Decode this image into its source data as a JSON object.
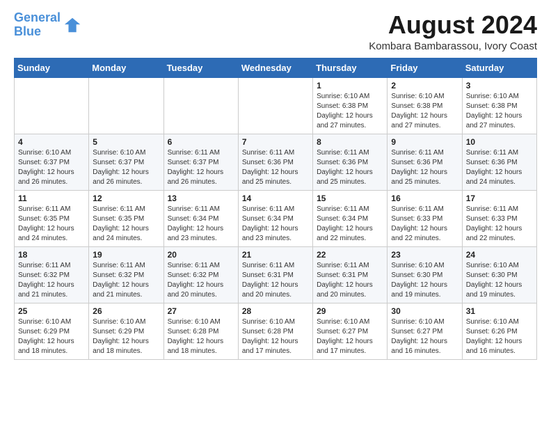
{
  "logo": {
    "line1": "General",
    "line2": "Blue"
  },
  "title": "August 2024",
  "subtitle": "Kombara Bambarassou, Ivory Coast",
  "days_of_week": [
    "Sunday",
    "Monday",
    "Tuesday",
    "Wednesday",
    "Thursday",
    "Friday",
    "Saturday"
  ],
  "weeks": [
    [
      {
        "day": "",
        "info": ""
      },
      {
        "day": "",
        "info": ""
      },
      {
        "day": "",
        "info": ""
      },
      {
        "day": "",
        "info": ""
      },
      {
        "day": "1",
        "info": "Sunrise: 6:10 AM\nSunset: 6:38 PM\nDaylight: 12 hours\nand 27 minutes."
      },
      {
        "day": "2",
        "info": "Sunrise: 6:10 AM\nSunset: 6:38 PM\nDaylight: 12 hours\nand 27 minutes."
      },
      {
        "day": "3",
        "info": "Sunrise: 6:10 AM\nSunset: 6:38 PM\nDaylight: 12 hours\nand 27 minutes."
      }
    ],
    [
      {
        "day": "4",
        "info": "Sunrise: 6:10 AM\nSunset: 6:37 PM\nDaylight: 12 hours\nand 26 minutes."
      },
      {
        "day": "5",
        "info": "Sunrise: 6:10 AM\nSunset: 6:37 PM\nDaylight: 12 hours\nand 26 minutes."
      },
      {
        "day": "6",
        "info": "Sunrise: 6:11 AM\nSunset: 6:37 PM\nDaylight: 12 hours\nand 26 minutes."
      },
      {
        "day": "7",
        "info": "Sunrise: 6:11 AM\nSunset: 6:36 PM\nDaylight: 12 hours\nand 25 minutes."
      },
      {
        "day": "8",
        "info": "Sunrise: 6:11 AM\nSunset: 6:36 PM\nDaylight: 12 hours\nand 25 minutes."
      },
      {
        "day": "9",
        "info": "Sunrise: 6:11 AM\nSunset: 6:36 PM\nDaylight: 12 hours\nand 25 minutes."
      },
      {
        "day": "10",
        "info": "Sunrise: 6:11 AM\nSunset: 6:36 PM\nDaylight: 12 hours\nand 24 minutes."
      }
    ],
    [
      {
        "day": "11",
        "info": "Sunrise: 6:11 AM\nSunset: 6:35 PM\nDaylight: 12 hours\nand 24 minutes."
      },
      {
        "day": "12",
        "info": "Sunrise: 6:11 AM\nSunset: 6:35 PM\nDaylight: 12 hours\nand 24 minutes."
      },
      {
        "day": "13",
        "info": "Sunrise: 6:11 AM\nSunset: 6:34 PM\nDaylight: 12 hours\nand 23 minutes."
      },
      {
        "day": "14",
        "info": "Sunrise: 6:11 AM\nSunset: 6:34 PM\nDaylight: 12 hours\nand 23 minutes."
      },
      {
        "day": "15",
        "info": "Sunrise: 6:11 AM\nSunset: 6:34 PM\nDaylight: 12 hours\nand 22 minutes."
      },
      {
        "day": "16",
        "info": "Sunrise: 6:11 AM\nSunset: 6:33 PM\nDaylight: 12 hours\nand 22 minutes."
      },
      {
        "day": "17",
        "info": "Sunrise: 6:11 AM\nSunset: 6:33 PM\nDaylight: 12 hours\nand 22 minutes."
      }
    ],
    [
      {
        "day": "18",
        "info": "Sunrise: 6:11 AM\nSunset: 6:32 PM\nDaylight: 12 hours\nand 21 minutes."
      },
      {
        "day": "19",
        "info": "Sunrise: 6:11 AM\nSunset: 6:32 PM\nDaylight: 12 hours\nand 21 minutes."
      },
      {
        "day": "20",
        "info": "Sunrise: 6:11 AM\nSunset: 6:32 PM\nDaylight: 12 hours\nand 20 minutes."
      },
      {
        "day": "21",
        "info": "Sunrise: 6:11 AM\nSunset: 6:31 PM\nDaylight: 12 hours\nand 20 minutes."
      },
      {
        "day": "22",
        "info": "Sunrise: 6:11 AM\nSunset: 6:31 PM\nDaylight: 12 hours\nand 20 minutes."
      },
      {
        "day": "23",
        "info": "Sunrise: 6:10 AM\nSunset: 6:30 PM\nDaylight: 12 hours\nand 19 minutes."
      },
      {
        "day": "24",
        "info": "Sunrise: 6:10 AM\nSunset: 6:30 PM\nDaylight: 12 hours\nand 19 minutes."
      }
    ],
    [
      {
        "day": "25",
        "info": "Sunrise: 6:10 AM\nSunset: 6:29 PM\nDaylight: 12 hours\nand 18 minutes."
      },
      {
        "day": "26",
        "info": "Sunrise: 6:10 AM\nSunset: 6:29 PM\nDaylight: 12 hours\nand 18 minutes."
      },
      {
        "day": "27",
        "info": "Sunrise: 6:10 AM\nSunset: 6:28 PM\nDaylight: 12 hours\nand 18 minutes."
      },
      {
        "day": "28",
        "info": "Sunrise: 6:10 AM\nSunset: 6:28 PM\nDaylight: 12 hours\nand 17 minutes."
      },
      {
        "day": "29",
        "info": "Sunrise: 6:10 AM\nSunset: 6:27 PM\nDaylight: 12 hours\nand 17 minutes."
      },
      {
        "day": "30",
        "info": "Sunrise: 6:10 AM\nSunset: 6:27 PM\nDaylight: 12 hours\nand 16 minutes."
      },
      {
        "day": "31",
        "info": "Sunrise: 6:10 AM\nSunset: 6:26 PM\nDaylight: 12 hours\nand 16 minutes."
      }
    ]
  ]
}
